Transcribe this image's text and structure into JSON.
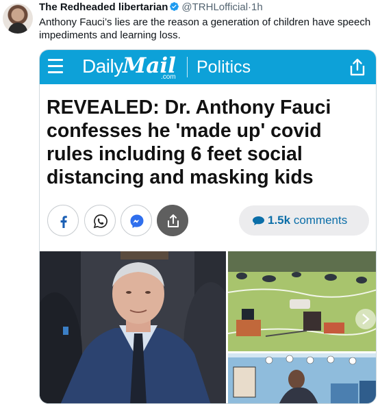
{
  "tweet": {
    "author_name": "The Redheaded libertarian",
    "handle": "@TRHLofficial",
    "separator": "·",
    "time": "1h",
    "text": "Anthony Fauci’s lies are the reason a generation of children have speech impediments and learning loss."
  },
  "card": {
    "brand_daily": "Daily",
    "brand_mail": "Mail",
    "brand_com": ".com",
    "section": "Politics",
    "headline": "REVEALED: Dr. Anthony Fauci confesses he 'made up' covid rules including 6 feet social distancing and masking kids",
    "comments_count": "1.5k",
    "comments_label": "comments"
  },
  "colors": {
    "dailymail_blue": "#0da1d8",
    "verified_blue": "#1d9bf0",
    "comments_text": "#0b6ea8"
  },
  "icons": [
    "menu-icon",
    "share-icon",
    "facebook-icon",
    "whatsapp-icon",
    "messenger-icon",
    "comment-bubble-icon",
    "verified-icon",
    "chevron-right-icon"
  ]
}
